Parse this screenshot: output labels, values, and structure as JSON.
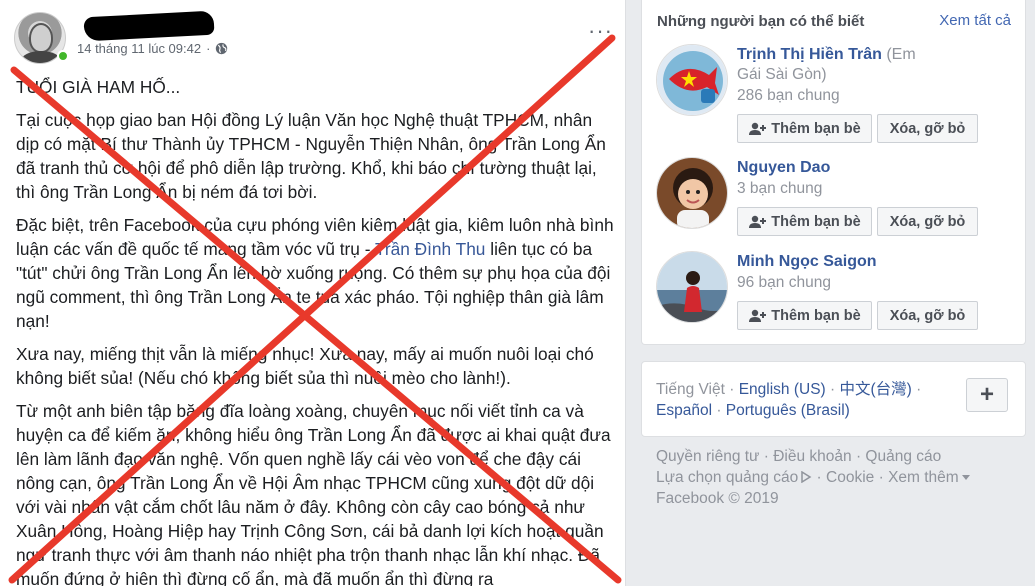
{
  "post": {
    "timestamp": "14 tháng 11 lúc 09:42",
    "separator": "·",
    "more_icon": "···",
    "paragraphs": [
      "TUỔI GIÀ HAM HỐ...",
      "Tại cuộc họp giao ban Hội đồng Lý luận Văn học Nghệ thuật TPHCM, nhân dịp có mặt Bí thư Thành ủy TPHCM - Nguyễn Thiện Nhân, ông Trần Long Ẩn đã tranh thủ cơ hội để phô diễn lập trường. Khổ, khi báo chí tường thuật lại, thì ông Trần Long Ẩn bị ném đá tơi bời.",
      "Từ một anh biên tập băng đĩa loàng xoàng, chuyên mục nối viết tỉnh ca và huyện ca để kiếm ăn, không hiểu ông Trần Long Ẩn đã được ai khai quật đưa lên làm lãnh đạo văn nghệ. Vốn quen nghề lấy cái vèo von để che đậy cái nông cạn, ông Trần Long Ẩn về Hội Âm nhạc TPHCM cũng xung đột dữ dội với vài nhân vật cắm chốt lâu năm ở đây. Không còn cây cao bóng cả như Xuân Hồng, Hoàng Hiệp hay Trịnh Công Sơn, cái bả danh lợi kích hoạt quần ngư tranh thực với âm thanh náo nhiệt pha trộn thanh nhạc lẫn khí nhạc. Đã muốn đứng ở hiên thì đừng cố ẩn, mà đã muốn ẩn thì đừng ra"
    ],
    "p3_before": "Đặc biệt, trên Facebook của cựu phóng viên kiêm luật gia, kiêm luôn nhà bình luận các vấn đề quốc tế mang tầm vóc vũ trụ - ",
    "p3_link": "Trần Đình Thu",
    "p3_after": " liên tục có ba \"tút\" chửi ông Trần Long Ẩn lên bờ xuống ruộng. Có thêm sự phụ họa của đội ngũ comment, thì ông Trần Long Ẩn te tua xác pháo. Tội nghiệp thân già lâm nạn!",
    "p4": "Xưa nay, miếng thịt vẫn là miếng nhục! Xưa nay, mấy ai muốn nuôi loại chó không biết sủa! (Nếu chó không biết sủa thì nuôi mèo cho lành!)."
  },
  "suggestions": {
    "title": "Những người bạn có thể biết",
    "see_all": "Xem tất cả",
    "add_label": "Thêm bạn bè",
    "remove_label": "Xóa, gỡ bỏ",
    "friends": [
      {
        "name": "Trịnh Thị Hiền Trân",
        "note": " (Em",
        "note2": "Gái Sài Gòn)",
        "mutual": "286 bạn chung"
      },
      {
        "name": "Nguyen Dao",
        "mutual": "3 bạn chung"
      },
      {
        "name": "Minh Ngọc Saigon",
        "mutual": "96 bạn chung"
      }
    ]
  },
  "languages": {
    "current": "Tiếng Việt",
    "items": [
      "English (US)",
      "中文(台灣)",
      "Español",
      "Português (Brasil)"
    ],
    "sep": " · ",
    "plus": "+"
  },
  "footer": {
    "links": [
      "Quyền riêng tư",
      "Điều khoản",
      "Quảng cáo",
      "Lựa chọn quảng cáo",
      "Cookie",
      "Xem thêm"
    ],
    "copyright": "Facebook © 2019"
  },
  "colors": {
    "link": "#365899",
    "cross": "#e8392b",
    "online": "#42b72a"
  }
}
